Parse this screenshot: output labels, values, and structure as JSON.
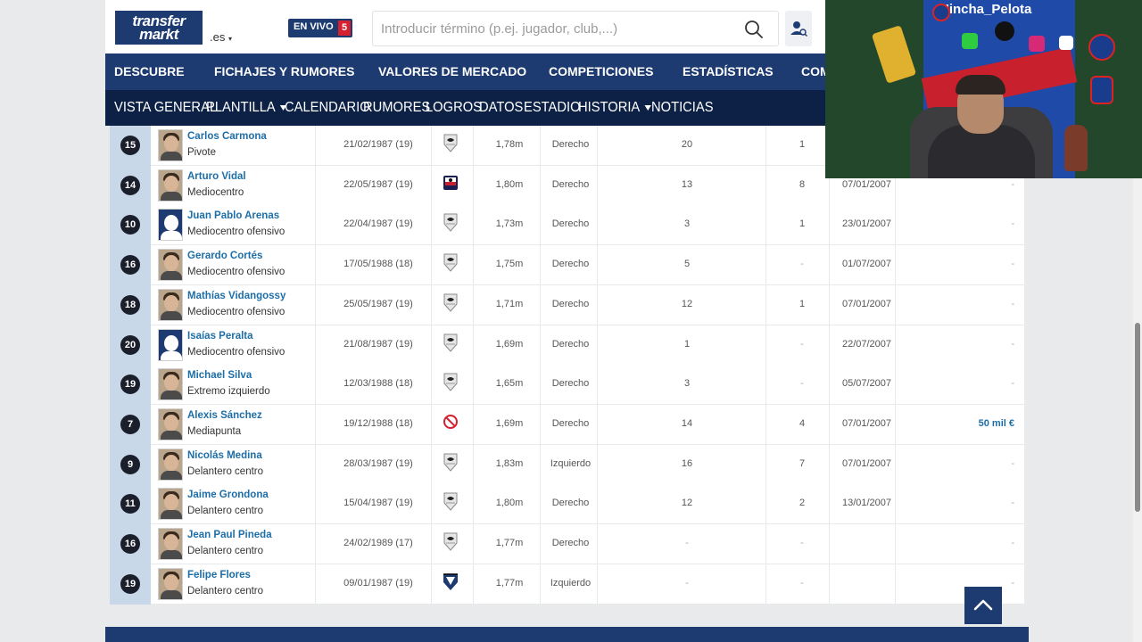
{
  "header": {
    "logo_line1": "transfer",
    "logo_line2": "markt",
    "domain": ".es",
    "live_label": "EN VIVO",
    "live_count": "5",
    "search_placeholder": "Introducir término (p.ej. jugador, club,...)"
  },
  "main_nav": [
    "DESCUBRE",
    "FICHAJES Y RUMORES",
    "VALORES DE MERCADO",
    "COMPETICIONES",
    "ESTADÍSTICAS",
    "COM"
  ],
  "sub_nav": [
    {
      "label": "VISTA GENERAL",
      "dropdown": false
    },
    {
      "label": "PLANTILLA",
      "dropdown": true
    },
    {
      "label": "CALENDARIO",
      "dropdown": false
    },
    {
      "label": "RUMORES",
      "dropdown": false
    },
    {
      "label": "LOGROS",
      "dropdown": false
    },
    {
      "label": "DATOS",
      "dropdown": false
    },
    {
      "label": "ESTADIO",
      "dropdown": false
    },
    {
      "label": "HISTORIA",
      "dropdown": true
    },
    {
      "label": "NOTICIAS",
      "dropdown": false
    }
  ],
  "players": [
    {
      "num": "15",
      "name": "Carlos Carmona",
      "position": "Pivote",
      "dob": "21/02/1987 (19)",
      "club": "chile",
      "height": "1,78m",
      "foot": "Derecho",
      "apps": "20",
      "goals": "1",
      "joined": "",
      "value": "",
      "photo": "face"
    },
    {
      "num": "14",
      "name": "Arturo Vidal",
      "position": "Mediocentro",
      "dob": "22/05/1987 (19)",
      "club": "colo",
      "height": "1,80m",
      "foot": "Derecho",
      "apps": "13",
      "goals": "8",
      "joined": "07/01/2007",
      "value": "-",
      "photo": "face"
    },
    {
      "num": "10",
      "name": "Juan Pablo Arenas",
      "position": "Mediocentro ofensivo",
      "dob": "22/04/1987 (19)",
      "club": "chile",
      "height": "1,73m",
      "foot": "Derecho",
      "apps": "3",
      "goals": "1",
      "joined": "23/01/2007",
      "value": "-",
      "photo": "blank"
    },
    {
      "num": "16",
      "name": "Gerardo Cortés",
      "position": "Mediocentro ofensivo",
      "dob": "17/05/1988 (18)",
      "club": "chile",
      "height": "1,75m",
      "foot": "Derecho",
      "apps": "5",
      "goals": "-",
      "joined": "01/07/2007",
      "value": "-",
      "photo": "face"
    },
    {
      "num": "18",
      "name": "Mathías Vidangossy",
      "position": "Mediocentro ofensivo",
      "dob": "25/05/1987 (19)",
      "club": "chile",
      "height": "1,71m",
      "foot": "Derecho",
      "apps": "12",
      "goals": "1",
      "joined": "07/01/2007",
      "value": "-",
      "photo": "face"
    },
    {
      "num": "20",
      "name": "Isaías Peralta",
      "position": "Mediocentro ofensivo",
      "dob": "21/08/1987 (19)",
      "club": "chile",
      "height": "1,69m",
      "foot": "Derecho",
      "apps": "1",
      "goals": "-",
      "joined": "22/07/2007",
      "value": "-",
      "photo": "blank"
    },
    {
      "num": "19",
      "name": "Michael Silva",
      "position": "Extremo izquierdo",
      "dob": "12/03/1988 (18)",
      "club": "chile",
      "height": "1,65m",
      "foot": "Derecho",
      "apps": "3",
      "goals": "-",
      "joined": "05/07/2007",
      "value": "-",
      "photo": "face"
    },
    {
      "num": "7",
      "name": "Alexis Sánchez",
      "position": "Mediapunta",
      "dob": "19/12/1988 (18)",
      "club": "none",
      "height": "1,69m",
      "foot": "Derecho",
      "apps": "14",
      "goals": "4",
      "joined": "07/01/2007",
      "value": "50 mil €",
      "photo": "face"
    },
    {
      "num": "9",
      "name": "Nicolás Medina",
      "position": "Delantero centro",
      "dob": "28/03/1987 (19)",
      "club": "chile",
      "height": "1,83m",
      "foot": "Izquierdo",
      "apps": "16",
      "goals": "7",
      "joined": "07/01/2007",
      "value": "-",
      "photo": "face"
    },
    {
      "num": "11",
      "name": "Jaime Grondona",
      "position": "Delantero centro",
      "dob": "15/04/1987 (19)",
      "club": "chile",
      "height": "1,80m",
      "foot": "Derecho",
      "apps": "12",
      "goals": "2",
      "joined": "13/01/2007",
      "value": "-",
      "photo": "face"
    },
    {
      "num": "16",
      "name": "Jean Paul Pineda",
      "position": "Delantero centro",
      "dob": "24/02/1989 (17)",
      "club": "chile",
      "height": "1,77m",
      "foot": "Derecho",
      "apps": "-",
      "goals": "-",
      "joined": "",
      "value": "-",
      "photo": "face"
    },
    {
      "num": "19",
      "name": "Felipe Flores",
      "position": "Delantero centro",
      "dob": "09/01/1987 (19)",
      "club": "huachipato",
      "height": "1,77m",
      "foot": "Izquierdo",
      "apps": "-",
      "goals": "-",
      "joined": "",
      "value": "-",
      "photo": "face"
    }
  ],
  "webcam": {
    "banner": "Hincha_Pelota"
  },
  "colors": {
    "navy": "#1d3b71",
    "dark_navy": "#0d2146",
    "link_blue": "#1d6ea8",
    "live_red": "#d6202f",
    "num_cell_bg": "#c9d8e8"
  }
}
